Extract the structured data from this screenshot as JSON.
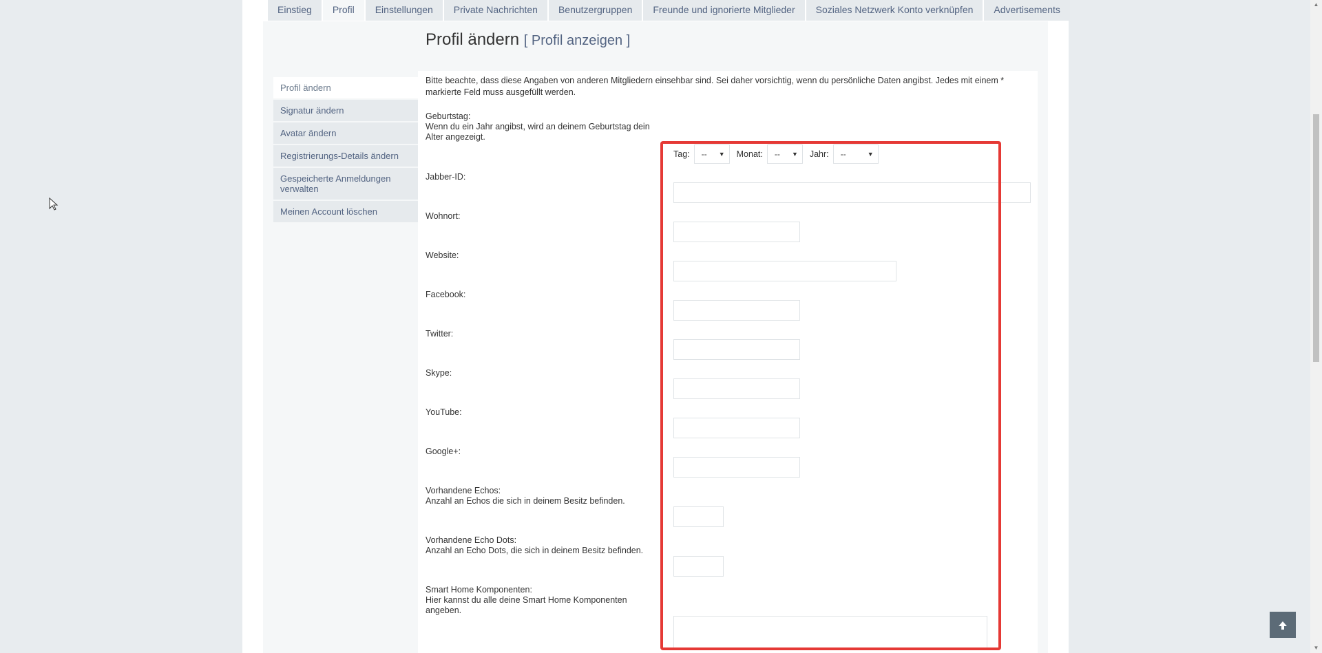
{
  "tabs": [
    {
      "label": "Einstieg",
      "active": false
    },
    {
      "label": "Profil",
      "active": true
    },
    {
      "label": "Einstellungen",
      "active": false
    },
    {
      "label": "Private Nachrichten",
      "active": false
    },
    {
      "label": "Benutzergruppen",
      "active": false
    },
    {
      "label": "Freunde und ignorierte Mitglieder",
      "active": false
    },
    {
      "label": "Soziales Netzwerk Konto verknüpfen",
      "active": false
    },
    {
      "label": "Advertisements",
      "active": false
    }
  ],
  "title": {
    "main": "Profil ändern",
    "bracket_open": "[",
    "view_link": "Profil anzeigen",
    "bracket_close": "]"
  },
  "sidenav": [
    {
      "label": "Profil ändern",
      "active": true
    },
    {
      "label": "Signatur ändern",
      "active": false
    },
    {
      "label": "Avatar ändern",
      "active": false
    },
    {
      "label": "Registrierungs-Details ändern",
      "active": false
    },
    {
      "label": "Gespeicherte Anmeldungen verwalten",
      "active": false
    },
    {
      "label": "Meinen Account löschen",
      "active": false
    }
  ],
  "form": {
    "note": "Bitte beachte, dass diese Angaben von anderen Mitgliedern einsehbar sind. Sei daher vorsichtig, wenn du persönliche Daten angibst. Jedes mit einem * markierte Feld muss ausgefüllt werden.",
    "birthday": {
      "label": "Geburtstag:",
      "explain": "Wenn du ein Jahr angibst, wird an deinem Geburtstag dein Alter angezeigt.",
      "day_label": "Tag:",
      "day_value": "--",
      "month_label": "Monat:",
      "month_value": "--",
      "year_label": "Jahr:",
      "year_value": "--"
    },
    "jabber": {
      "label": "Jabber-ID:",
      "value": ""
    },
    "wohnort": {
      "label": "Wohnort:",
      "value": ""
    },
    "website": {
      "label": "Website:",
      "value": ""
    },
    "facebook": {
      "label": "Facebook:",
      "value": ""
    },
    "twitter": {
      "label": "Twitter:",
      "value": ""
    },
    "skype": {
      "label": "Skype:",
      "value": ""
    },
    "youtube": {
      "label": "YouTube:",
      "value": ""
    },
    "googleplus": {
      "label": "Google+:",
      "value": ""
    },
    "echos": {
      "label": "Vorhandene Echos:",
      "explain": "Anzahl an Echos die sich in deinem Besitz befinden.",
      "value": ""
    },
    "echo_dots": {
      "label": "Vorhandene Echo Dots:",
      "explain": "Anzahl an Echo Dots, die sich in deinem Besitz befinden.",
      "value": ""
    },
    "smarthome": {
      "label": "Smart Home Komponenten:",
      "explain": "Hier kannst du alle deine Smart Home Komponenten angeben.",
      "value": ""
    }
  },
  "icons": {
    "select_arrow": "▼",
    "to_top": "arrow-up-icon",
    "cursor": "mouse-pointer-icon"
  },
  "colors": {
    "highlight": "#e53935",
    "link": "#536482",
    "page_bg": "#e8ecef"
  }
}
